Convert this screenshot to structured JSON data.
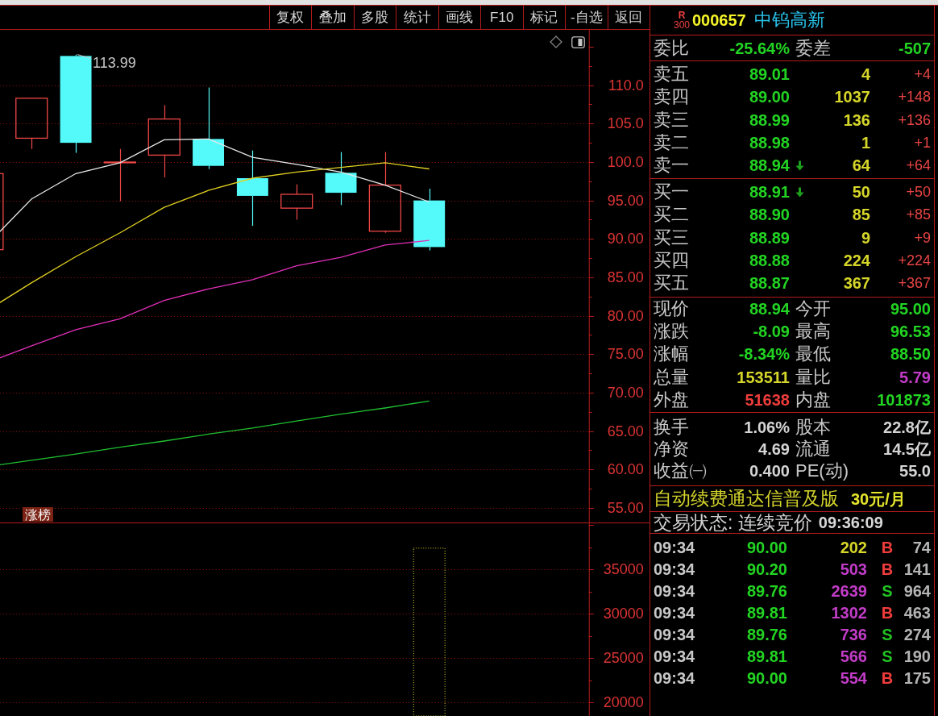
{
  "toolbar": {
    "buttons": [
      "复权",
      "叠加",
      "多股",
      "统计",
      "画线",
      "F10",
      "标记",
      "-自选",
      "返回"
    ]
  },
  "chart": {
    "badge": "涨榜",
    "chart_data": [
      {
        "type": "candlestick",
        "categories": [
          null,
          null,
          null,
          null,
          null,
          null,
          null,
          null,
          null,
          null,
          null,
          null,
          null,
          null
        ],
        "ylim": [
          53.0,
          117.2
        ],
        "yticks": [
          {
            "value": 110,
            "label": "110.0"
          },
          {
            "value": 105,
            "label": "105.0"
          },
          {
            "value": 100,
            "label": "100.0"
          },
          {
            "value": 95,
            "label": "95.00"
          },
          {
            "value": 90,
            "label": "90.00"
          },
          {
            "value": 85,
            "label": "85.00"
          },
          {
            "value": 80,
            "label": "80.00"
          },
          {
            "value": 75,
            "label": "75.00"
          },
          {
            "value": 70,
            "label": "70.00"
          },
          {
            "value": 65,
            "label": "65.00"
          },
          {
            "value": 60,
            "label": "60.00"
          },
          {
            "value": 55,
            "label": "55.00"
          }
        ],
        "grid": true,
        "ohlc": [
          [
            88.6,
            98.5,
            88.6,
            98.5
          ],
          [
            103.1,
            108.3,
            101.7,
            108.3
          ],
          [
            113.8,
            113.99,
            101.2,
            102.5
          ],
          [
            99.9,
            101.7,
            94.9,
            100.0
          ],
          [
            100.9,
            107.4,
            98.0,
            105.6
          ],
          [
            103.0,
            109.7,
            99.1,
            99.5
          ],
          [
            97.9,
            101.5,
            91.7,
            95.6
          ],
          [
            94.0,
            97.1,
            92.5,
            95.8
          ],
          [
            98.6,
            101.3,
            94.4,
            96.0
          ],
          [
            91.0,
            101.3,
            90.8,
            97.0
          ],
          [
            95.0,
            96.53,
            88.5,
            88.94
          ],
          null,
          null,
          null
        ],
        "series": [
          {
            "type": "line",
            "color": "#e8e8e8",
            "values": [
              89.3,
              95.2,
              98.5,
              99.9,
              102.9,
              103.0,
              100.6,
              99.7,
              98.7,
              97.0,
              94.8,
              null,
              null,
              null
            ]
          },
          {
            "type": "line",
            "color": "#e0d020",
            "values": [
              80.7,
              84.3,
              87.7,
              90.8,
              94.1,
              96.3,
              97.9,
              98.7,
              99.3,
              99.9,
              99.1,
              null,
              null,
              null
            ]
          },
          {
            "type": "line",
            "color": "#e030b8",
            "values": [
              73.9,
              76.1,
              78.2,
              79.6,
              82.0,
              83.5,
              84.7,
              86.5,
              87.6,
              89.2,
              89.8,
              null,
              null,
              null
            ]
          },
          {
            "type": "line",
            "color": "#20c030",
            "values": [
              60.4,
              61.2,
              62.0,
              62.9,
              63.7,
              64.6,
              65.4,
              66.3,
              67.2,
              68.0,
              68.9,
              null,
              null,
              null
            ]
          }
        ],
        "annotations": [
          "113.99"
        ]
      },
      {
        "type": "bar",
        "categories": [
          null,
          null,
          null,
          null,
          null,
          null,
          null,
          null,
          null,
          null,
          null,
          null,
          null,
          null
        ],
        "ylim": [
          18500,
          40200
        ],
        "yticks": [
          35000,
          30000,
          25000,
          20000
        ],
        "grid": true,
        "values": [
          null,
          null,
          null,
          null,
          null,
          null,
          null,
          null,
          null,
          null,
          37400,
          null,
          null,
          null
        ],
        "color": "#d8d020"
      }
    ]
  },
  "quote_panel": {
    "header": {
      "market_letter": "R",
      "market_number": "300",
      "code": "000657",
      "name": "中钨高新"
    },
    "order_ratio": [
      {
        "label": "委比",
        "value": "-25.64%"
      },
      {
        "label": "委差",
        "value": "-507"
      }
    ],
    "asks": [
      {
        "label": "卖五",
        "price": "89.01",
        "arrow_down": false,
        "volume": "4",
        "change": "+4"
      },
      {
        "label": "卖四",
        "price": "89.00",
        "arrow_down": false,
        "volume": "1037",
        "change": "+148"
      },
      {
        "label": "卖三",
        "price": "88.99",
        "arrow_down": false,
        "volume": "136",
        "change": "+136"
      },
      {
        "label": "卖二",
        "price": "88.98",
        "arrow_down": false,
        "volume": "1",
        "change": "+1"
      },
      {
        "label": "卖一",
        "price": "88.94",
        "arrow_down": true,
        "volume": "64",
        "change": "+64"
      }
    ],
    "bids": [
      {
        "label": "买一",
        "price": "88.91",
        "arrow_down": true,
        "volume": "50",
        "change": "+50"
      },
      {
        "label": "买二",
        "price": "88.90",
        "arrow_down": false,
        "volume": "85",
        "change": "+85"
      },
      {
        "label": "买三",
        "price": "88.89",
        "arrow_down": false,
        "volume": "9",
        "change": "+9"
      },
      {
        "label": "买四",
        "price": "88.88",
        "arrow_down": false,
        "volume": "224",
        "change": "+224"
      },
      {
        "label": "买五",
        "price": "88.87",
        "arrow_down": false,
        "volume": "367",
        "change": "+367"
      }
    ],
    "quote": [
      {
        "label": "现价",
        "value": "88.94",
        "color": "#22d422"
      },
      {
        "label": "今开",
        "value": "95.00",
        "color": "#22d422"
      },
      {
        "label": "涨跌",
        "value": "-8.09",
        "color": "#22d422"
      },
      {
        "label": "最高",
        "value": "96.53",
        "color": "#22d422"
      },
      {
        "label": "涨幅",
        "value": "-8.34%",
        "color": "#22d422"
      },
      {
        "label": "最低",
        "value": "88.50",
        "color": "#22d422"
      },
      {
        "label": "总量",
        "value": "153511",
        "color": "#d6d62a"
      },
      {
        "label": "量比",
        "value": "5.79",
        "color": "#c23cc8"
      },
      {
        "label": "外盘",
        "value": "51638",
        "color": "#ee3c3c"
      },
      {
        "label": "内盘",
        "value": "101873",
        "color": "#22d422"
      }
    ],
    "fundamentals": [
      {
        "label": "换手",
        "value": "1.06%"
      },
      {
        "label": "股本",
        "value": "22.8亿"
      },
      {
        "label": "净资",
        "value": "4.69"
      },
      {
        "label": "流通",
        "value": "14.5亿"
      },
      {
        "label": "收益㈠",
        "value": "0.400"
      },
      {
        "label": "PE(动)",
        "value": "55.0"
      }
    ],
    "promo": {
      "text": "自动续费通达信普及版",
      "price": "30元/月"
    },
    "trade_status": {
      "text": "交易状态: 连续竞价",
      "time": "09:36:09"
    },
    "ticks": [
      {
        "time": "09:34",
        "price": "90.00",
        "volume": {
          "text": "202",
          "color": "#d6d62a"
        },
        "side": {
          "text": "B",
          "color": "#f03c3c"
        },
        "count": "74"
      },
      {
        "time": "09:34",
        "price": "90.20",
        "volume": {
          "text": "503",
          "color": "#c23cc8"
        },
        "side": {
          "text": "B",
          "color": "#f03c3c"
        },
        "count": "141"
      },
      {
        "time": "09:34",
        "price": "89.76",
        "volume": {
          "text": "2639",
          "color": "#c23cc8"
        },
        "side": {
          "text": "S",
          "color": "#22c422"
        },
        "count": "964"
      },
      {
        "time": "09:34",
        "price": "89.81",
        "volume": {
          "text": "1302",
          "color": "#c23cc8"
        },
        "side": {
          "text": "B",
          "color": "#f03c3c"
        },
        "count": "463"
      },
      {
        "time": "09:34",
        "price": "89.76",
        "volume": {
          "text": "736",
          "color": "#c23cc8"
        },
        "side": {
          "text": "S",
          "color": "#22c422"
        },
        "count": "274"
      },
      {
        "time": "09:34",
        "price": "89.81",
        "volume": {
          "text": "566",
          "color": "#c23cc8"
        },
        "side": {
          "text": "S",
          "color": "#22c422"
        },
        "count": "190"
      },
      {
        "time": "09:34",
        "price": "90.00",
        "volume": {
          "text": "554",
          "color": "#c23cc8"
        },
        "side": {
          "text": "B",
          "color": "#f03c3c"
        },
        "count": "175"
      }
    ]
  }
}
